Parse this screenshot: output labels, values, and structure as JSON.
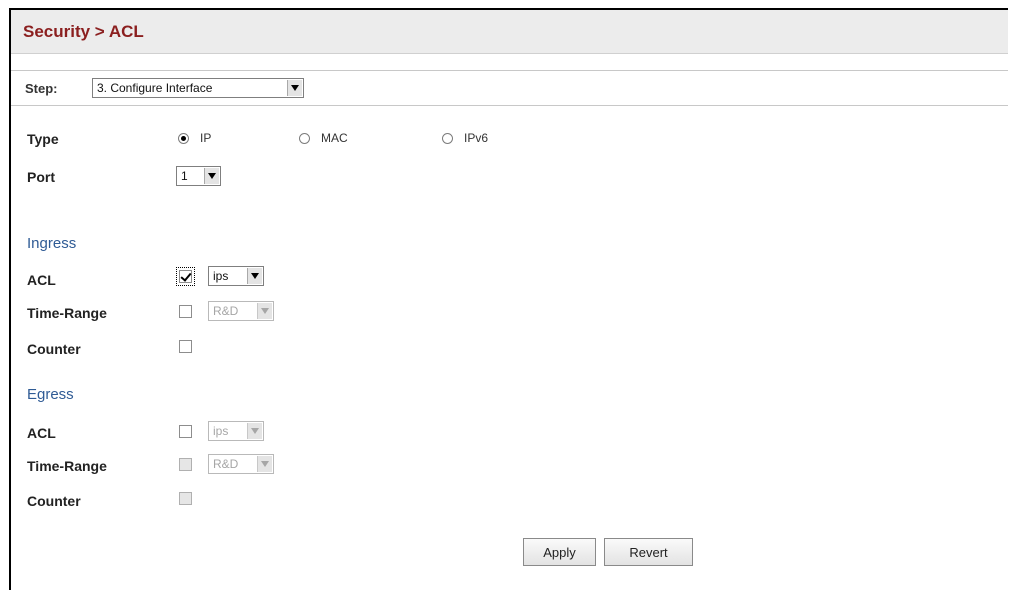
{
  "header": {
    "title": "Security > ACL"
  },
  "step": {
    "label": "Step:",
    "selected": "3. Configure Interface"
  },
  "form": {
    "type": {
      "label": "Type",
      "options": [
        {
          "label": "IP",
          "checked": true
        },
        {
          "label": "MAC",
          "checked": false
        },
        {
          "label": "IPv6",
          "checked": false
        }
      ]
    },
    "port": {
      "label": "Port",
      "selected": "1"
    }
  },
  "ingress": {
    "heading": "Ingress",
    "acl": {
      "label": "ACL",
      "checked": true,
      "selected": "ips"
    },
    "time_range": {
      "label": "Time-Range",
      "checked": false,
      "selected": "R&D"
    },
    "counter": {
      "label": "Counter",
      "checked": false
    }
  },
  "egress": {
    "heading": "Egress",
    "acl": {
      "label": "ACL",
      "checked": false,
      "selected": "ips"
    },
    "time_range": {
      "label": "Time-Range",
      "checked": false,
      "selected": "R&D"
    },
    "counter": {
      "label": "Counter",
      "checked": false
    }
  },
  "buttons": {
    "apply": "Apply",
    "revert": "Revert"
  },
  "colors": {
    "title": "#8b1f1f",
    "section": "#2f5b95"
  }
}
